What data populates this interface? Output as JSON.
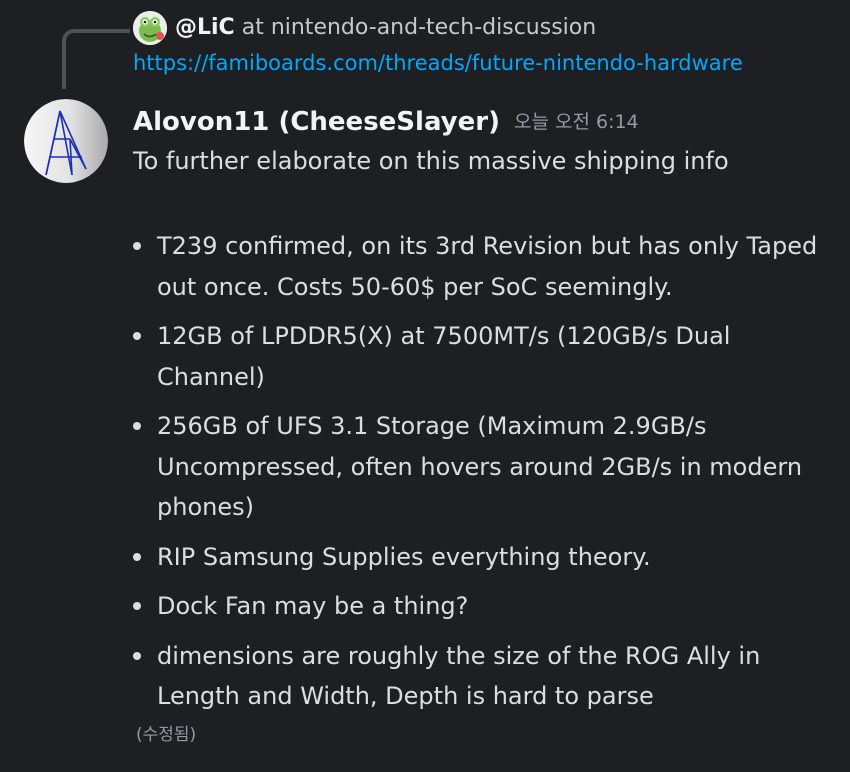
{
  "reply": {
    "author": "@LiC",
    "channel": " at nintendo-and-tech-discussion",
    "link": "https://famiboards.com/threads/future-nintendo-hardware"
  },
  "message": {
    "author": "Alovon11 (CheeseSlayer)",
    "timestamp": "오늘 오전 6:14",
    "lead": "To further elaborate on this massive shipping info",
    "bullets": [
      "T239 confirmed, on its 3rd Revision but has only Taped out once. Costs 50-60$ per SoC seemingly.",
      "12GB of LPDDR5(X) at 7500MT/s (120GB/s Dual Channel)",
      "256GB of UFS 3.1 Storage (Maximum 2.9GB/s Uncompressed, often hovers around 2GB/s in modern phones)",
      "RIP Samsung Supplies everything theory.",
      "Dock Fan may be a thing?",
      "dimensions are roughly the size of the ROG Ally in Length and Width, Depth is hard to parse"
    ],
    "edited": "(수정됨)"
  },
  "colors": {
    "background": "#1e1f22",
    "text": "#dbdee1",
    "link": "#00a8fc",
    "muted": "#949ba4",
    "author": "#f2f3f5"
  },
  "icons": {
    "reply_avatar": "frog-avatar-icon",
    "author_avatar": "geometric-logo-avatar-icon"
  }
}
